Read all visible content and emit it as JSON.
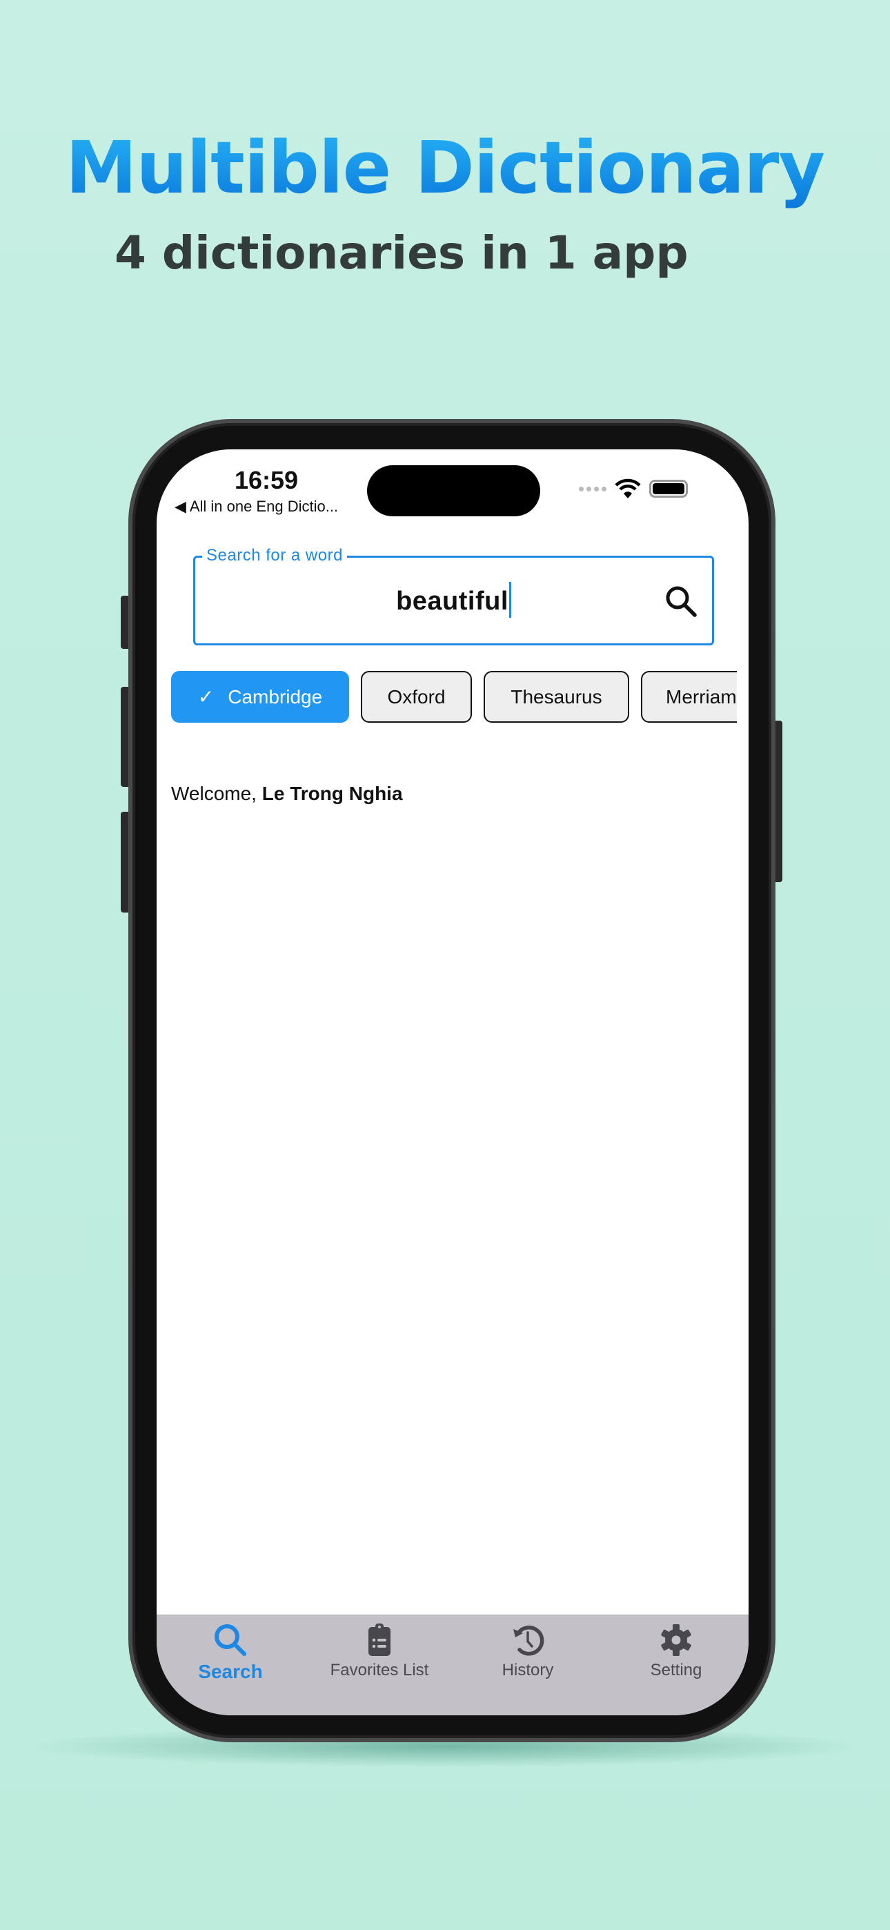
{
  "hero": {
    "title": "Multible Dictionary",
    "subtitle": "4 dictionaries in 1 app"
  },
  "status_bar": {
    "time": "16:59",
    "back_label": "◀ All in one Eng Dictio..."
  },
  "search": {
    "label": "Search for a word",
    "value": "beautiful"
  },
  "dictionaries": [
    {
      "label": "Cambridge",
      "selected": true
    },
    {
      "label": "Oxford",
      "selected": false
    },
    {
      "label": "Thesaurus",
      "selected": false
    },
    {
      "label": "Merriam",
      "selected": false
    }
  ],
  "welcome": {
    "prefix": "Welcome, ",
    "name": "Le Trong Nghia"
  },
  "tabs": [
    {
      "label": "Search",
      "icon": "search-icon",
      "active": true
    },
    {
      "label": "Favorites List",
      "icon": "clipboard-list-icon",
      "active": false
    },
    {
      "label": "History",
      "icon": "history-icon",
      "active": false
    },
    {
      "label": "Setting",
      "icon": "gear-icon",
      "active": false
    }
  ],
  "colors": {
    "accent": "#2196f3",
    "tab_bar": "#c3c0c7",
    "background": "#c0ede0"
  }
}
